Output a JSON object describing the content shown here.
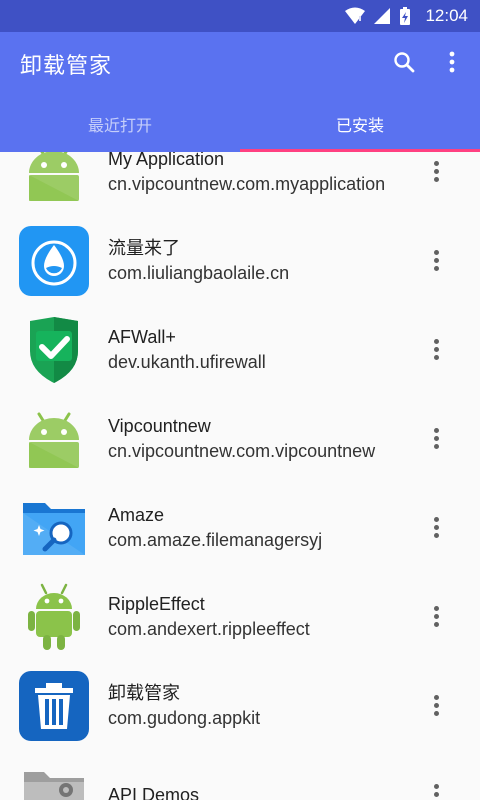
{
  "status_bar": {
    "time": "12:04",
    "icons": [
      "wifi-icon",
      "signal-icon",
      "battery-charging-icon"
    ]
  },
  "app_bar": {
    "title": "卸载管家",
    "actions": [
      "search-icon",
      "overflow-menu-icon"
    ]
  },
  "tabs": [
    {
      "label": "最近打开",
      "active": false
    },
    {
      "label": "已安装",
      "active": true
    }
  ],
  "colors": {
    "status_bar": "#3f51c5",
    "primary": "#5a72f0",
    "tab_indicator": "#ff4081",
    "background": "#fafafa"
  },
  "apps": [
    {
      "name": "My Application",
      "package": "cn.vipcountnew.com.myapplication",
      "icon": "android-robot-icon"
    },
    {
      "name": "流量来了",
      "package": "com.liuliangbaolaile.cn",
      "icon": "water-drop-icon"
    },
    {
      "name": "AFWall+",
      "package": "dev.ukanth.ufirewall",
      "icon": "shield-check-icon"
    },
    {
      "name": "Vipcountnew",
      "package": "cn.vipcountnew.com.vipcountnew",
      "icon": "android-robot-icon"
    },
    {
      "name": "Amaze",
      "package": "com.amaze.filemanagersyj",
      "icon": "folder-search-icon"
    },
    {
      "name": "RippleEffect",
      "package": "com.andexert.rippleeffect",
      "icon": "android-3d-robot-icon"
    },
    {
      "name": "卸载管家",
      "package": "com.gudong.appkit",
      "icon": "trash-can-icon"
    },
    {
      "name": "API Demos",
      "package": "",
      "icon": "gear-folder-icon"
    }
  ]
}
